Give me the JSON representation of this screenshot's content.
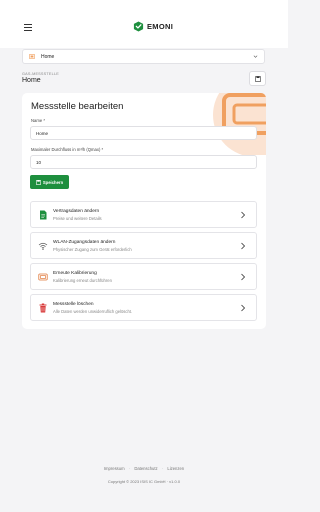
{
  "header": {
    "brand": "EMONI",
    "menu_icon": "hamburger-icon",
    "logo_icon": "emoni-logo-icon"
  },
  "location_select": {
    "value": "Home",
    "icon": "home-icon"
  },
  "section": {
    "label": "GAS-MESSSTELLE",
    "title": "Home"
  },
  "card": {
    "title": "Messstelle bearbeiten",
    "name_label": "Name *",
    "name_value": "Home",
    "flow_label": "Maximaler Durchfluss in m³/h (Qmax) *",
    "flow_value": "10",
    "save_label": "Speichern"
  },
  "actions": [
    {
      "title": "Vertragsdaten ändern",
      "subtitle": "Preise und weitere Details",
      "icon": "contract-document-icon"
    },
    {
      "title": "WLAN-Zugangsdaten ändern",
      "subtitle": "Physischer Zugang zum Gerät erforderlich",
      "icon": "wifi-icon"
    },
    {
      "title": "Erneute Kalibrierung",
      "subtitle": "Kalibrierung erneut durchführen",
      "icon": "calibration-icon"
    },
    {
      "title": "Messstelle löschen",
      "subtitle": "Alle Daten werden unwiderruflich gelöscht.",
      "icon": "trash-icon"
    }
  ],
  "footer": {
    "links": [
      "Impressum",
      "Datenschutz",
      "Lizenzen"
    ],
    "copyright": "Copyright © 2023 ISIS IC GmbH",
    "version": "v1.0.0"
  },
  "colors": {
    "primary_green": "#1e8f3e",
    "accent_orange": "#f0a060",
    "danger_red": "#d83a3a"
  }
}
